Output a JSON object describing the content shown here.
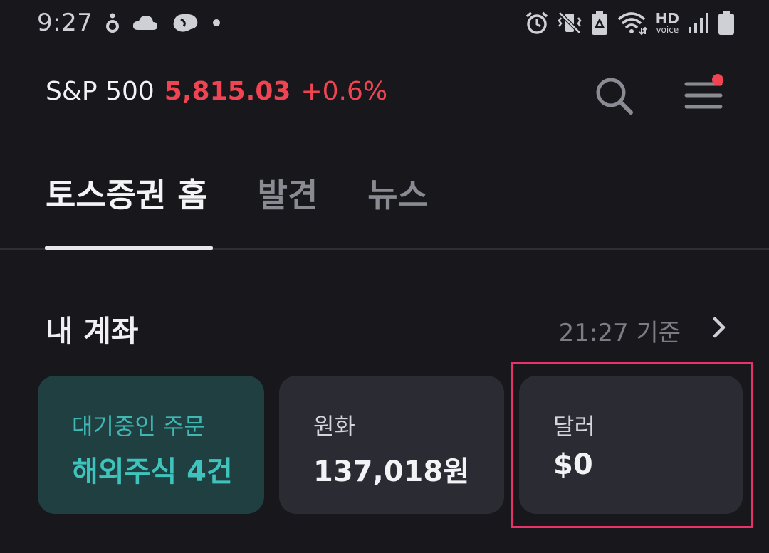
{
  "status_bar": {
    "time": "9:27",
    "left_icons": [
      "notification-drop-icon",
      "cloud-icon",
      "weather-icon",
      "dot-icon"
    ],
    "right_icons": [
      "alarm-icon",
      "vibrate-icon",
      "battery-saver-icon",
      "wifi-icon",
      "hd-voice-icon",
      "signal-icon",
      "battery-icon"
    ],
    "hd_label": "HD",
    "voice_label": "voice"
  },
  "header": {
    "index_name": "S&P 500",
    "index_value": "5,815.03",
    "index_change": "+0.6%",
    "index_color": "#f04452",
    "has_notification": true
  },
  "tabs": [
    {
      "label": "토스증권 홈",
      "active": true
    },
    {
      "label": "발견",
      "active": false
    },
    {
      "label": "뉴스",
      "active": false
    }
  ],
  "account": {
    "title": "내 계좌",
    "as_of": "21:27 기준",
    "cards": [
      {
        "label": "대기중인 주문",
        "value": "해외주식 4건",
        "accent": "#3fc3bd"
      },
      {
        "label": "원화",
        "value": "137,018원"
      },
      {
        "label": "달러",
        "value": "$0"
      }
    ]
  },
  "colors": {
    "background": "#17171c",
    "card": "#2b2b33",
    "pending_card": "#1f3f41",
    "highlight": "#e8336a"
  }
}
